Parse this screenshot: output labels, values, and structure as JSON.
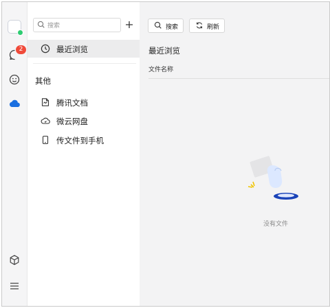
{
  "app": {
    "rail": {
      "chat_badge": "2",
      "icons": [
        "avatar",
        "chat-icon",
        "emoji-icon",
        "cloud-icon",
        "cube-icon",
        "menu-icon"
      ]
    },
    "nav": {
      "search_placeholder": "搜索",
      "items": [
        {
          "label": "最近浏览",
          "icon": "clock-icon",
          "active": true
        }
      ],
      "section_title": "其他",
      "other_items": [
        {
          "label": "腾讯文档",
          "icon": "docs-icon"
        },
        {
          "label": "微云网盘",
          "icon": "cloud-drive-icon"
        },
        {
          "label": "传文件到手机",
          "icon": "phone-icon"
        }
      ]
    },
    "main": {
      "toolbar": {
        "search_label": "搜索",
        "refresh_label": "刷新"
      },
      "title": "最近浏览",
      "column_header": "文件名称",
      "empty_text": "没有文件"
    },
    "colors": {
      "accent_blue": "#1a6fe0",
      "badge_red": "#f04a3a",
      "online_green": "#2ecc71"
    }
  }
}
